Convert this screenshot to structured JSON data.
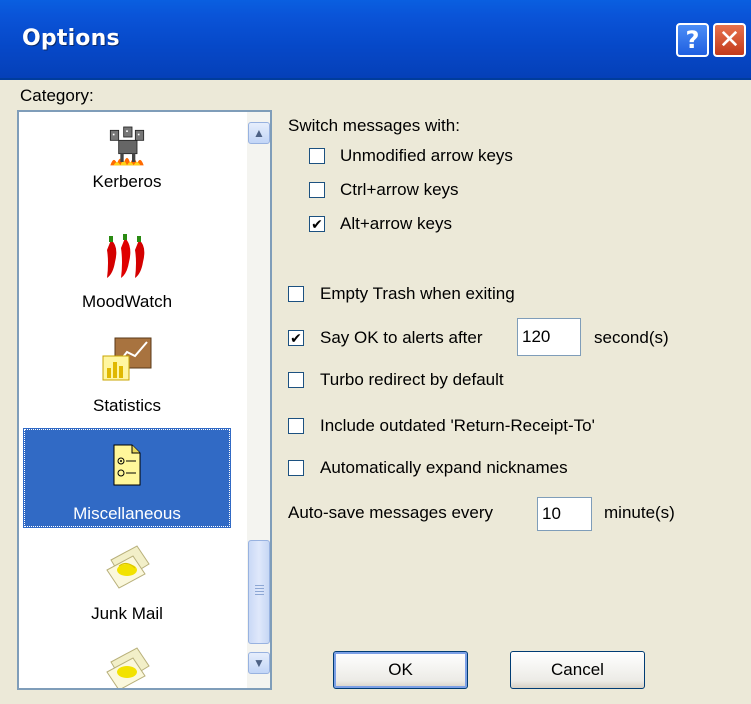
{
  "window": {
    "title": "Options"
  },
  "title_buttons": {
    "help": "?",
    "close": "✕"
  },
  "category": {
    "label": "Category:",
    "items": [
      {
        "label": "Kerberos",
        "icon": "kerberos-icon",
        "selected": false
      },
      {
        "label": "MoodWatch",
        "icon": "chili-peppers-icon",
        "selected": false
      },
      {
        "label": "Statistics",
        "icon": "statistics-chart-icon",
        "selected": false
      },
      {
        "label": "Miscellaneous",
        "icon": "miscellaneous-document-icon",
        "selected": true
      },
      {
        "label": "Junk Mail",
        "icon": "junk-mail-icon",
        "selected": false
      },
      {
        "label": "",
        "icon": "junk-mail-icon",
        "selected": false
      }
    ]
  },
  "options": {
    "switch_heading": "Switch messages with:",
    "unmodified_arrow": {
      "label": "Unmodified arrow keys",
      "checked": false
    },
    "ctrl_arrow": {
      "label": "Ctrl+arrow keys",
      "checked": false
    },
    "alt_arrow": {
      "label": "Alt+arrow keys",
      "checked": true
    },
    "empty_trash": {
      "label": "Empty Trash when exiting",
      "checked": false
    },
    "say_ok": {
      "label": "Say OK to alerts after",
      "checked": true,
      "value": "120",
      "unit": "second(s)"
    },
    "turbo_redirect": {
      "label": "Turbo redirect by default",
      "checked": false
    },
    "return_receipt": {
      "label": "Include outdated 'Return-Receipt-To'",
      "checked": false
    },
    "expand_nicknames": {
      "label": "Automatically expand nicknames",
      "checked": false
    },
    "autosave": {
      "label": "Auto-save messages every",
      "value": "10",
      "unit": "minute(s)"
    }
  },
  "buttons": {
    "ok": "OK",
    "cancel": "Cancel"
  },
  "colors": {
    "titlebar": "#0a54d8",
    "selection": "#316ac5",
    "dialog": "#ece9d8"
  }
}
